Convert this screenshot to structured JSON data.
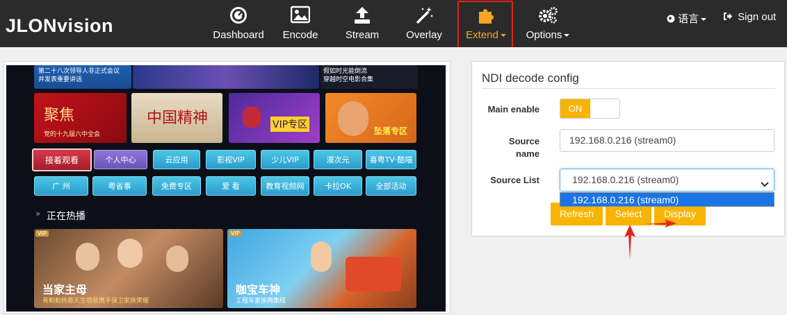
{
  "brand": {
    "name": "JLONvision"
  },
  "nav": {
    "dashboard": "Dashboard",
    "encode": "Encode",
    "stream": "Stream",
    "overlay": "Overlay",
    "extend": "Extend",
    "options": "Options"
  },
  "topright": {
    "language": "语言",
    "signout": "Sign out"
  },
  "preview": {
    "banner_left": "第二十八次领导人非正式会议\n并发表重要讲话",
    "banner_right": "假如时光能倒流\n穿越时空电影合集",
    "card1_title": "聚焦",
    "card1_sub": "党的十九届六中全会",
    "card2_title": "中国精神",
    "card3_title": "VIP专区",
    "card4_title": "坠落专区",
    "chips_row1": [
      "接着观看",
      "个人中心",
      "云应用",
      "影视VIP",
      "少儿VIP",
      "漫次元",
      "喜粤TV·酷喵"
    ],
    "chips_row2": [
      "广 州",
      "粤省事",
      "免费专区",
      "爱 看",
      "教育视频网",
      "卡拉OK",
      "全部活动"
    ],
    "section_title": "正在热播",
    "show1_title": "当家主母",
    "show1_sub": "蒋勤勤杨蓉天生宿敌携手保卫家族荣耀",
    "show2_title": "咖宝车神",
    "show2_sub": "工程车家族再集结",
    "vip_badge": "VIP"
  },
  "panel": {
    "title": "NDI decode config",
    "main_enable_label": "Main enable",
    "toggle_on": "ON",
    "source_name_label": "Source\nname",
    "source_name_value": "192.168.0.216 (stream0)",
    "source_list_label": "Source List",
    "source_list_value": "192.168.0.216 (stream0)",
    "source_list_option": "192.168.0.216 (stream0)",
    "btn_refresh": "Refresh",
    "btn_select": "Select",
    "btn_display": "Display"
  },
  "colors": {
    "accent": "#f8b400",
    "topbar": "#2b2b2b",
    "highlight_box": "#e0231c",
    "arrow": "#e8231b"
  }
}
